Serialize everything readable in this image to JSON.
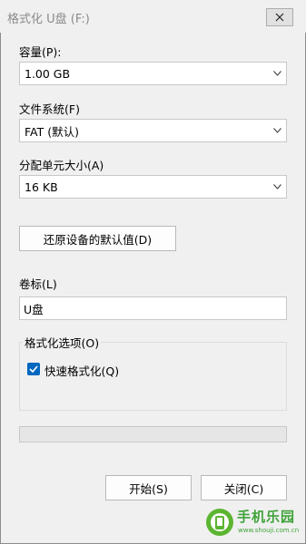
{
  "window": {
    "title": "格式化 U盘 (F:)"
  },
  "capacity": {
    "label": "容量(P):",
    "value": "1.00 GB"
  },
  "filesystem": {
    "label": "文件系统(F)",
    "value": "FAT (默认)"
  },
  "allocation": {
    "label": "分配单元大小(A)",
    "value": "16 KB"
  },
  "restore_defaults_label": "还原设备的默认值(D)",
  "volume": {
    "label": "卷标(L)",
    "value": "U盘"
  },
  "format_options": {
    "title": "格式化选项(O)",
    "quick_format_label": "快速格式化(Q)",
    "quick_format_checked": true
  },
  "progress": {
    "value": 0
  },
  "buttons": {
    "start": "开始(S)",
    "close": "关闭(C)"
  },
  "watermark": {
    "text": "手机乐园",
    "url": "www.shouji.com.cn"
  },
  "colors": {
    "accent": "#0067c0",
    "background": "#f0f0f0",
    "watermark": "#3fa33a"
  },
  "icons": {
    "close": "close-icon",
    "dropdown": "chevron-down-icon",
    "check": "check-icon"
  }
}
